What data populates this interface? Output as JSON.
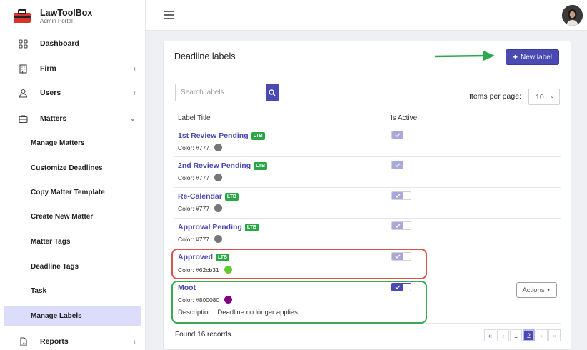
{
  "brand": {
    "title": "LawToolBox",
    "subtitle": "Admin Portal"
  },
  "sidebar": {
    "items": [
      {
        "label": "Dashboard",
        "icon": "grid-icon"
      },
      {
        "label": "Firm",
        "icon": "building-icon"
      },
      {
        "label": "Users",
        "icon": "users-icon"
      },
      {
        "label": "Matters",
        "icon": "briefcase-icon"
      },
      {
        "label": "Reports",
        "icon": "report-icon"
      }
    ],
    "subitems": [
      "Manage Matters",
      "Customize Deadlines",
      "Copy Matter Template",
      "Create New Matter",
      "Matter Tags",
      "Deadline Tags",
      "Task",
      "Manage Labels"
    ],
    "active": "Manage Labels"
  },
  "card": {
    "title": "Deadline labels",
    "new_label_button": "New label",
    "search_placeholder": "Search labels",
    "items_per_page_label": "Items per page:",
    "items_per_page_value": "10",
    "col_label_title": "Label Title",
    "col_is_active": "Is Active",
    "ltb_badge": "LTB",
    "actions_button": "Actions",
    "found": "Found 16 records.",
    "pager": [
      "«",
      "‹",
      "1",
      "2",
      "›",
      "»"
    ],
    "current_page": "2"
  },
  "labels": [
    {
      "title": "1st Review Pending",
      "ltb": true,
      "color_text": "Color: #777",
      "color": "#777777",
      "active": true
    },
    {
      "title": "2nd Review Pending",
      "ltb": true,
      "color_text": "Color: #777",
      "color": "#777777",
      "active": true
    },
    {
      "title": "Re-Calendar",
      "ltb": true,
      "color_text": "Color: #777",
      "color": "#777777",
      "active": true
    },
    {
      "title": "Approval Pending",
      "ltb": true,
      "color_text": "Color: #777",
      "color": "#777777",
      "active": true
    },
    {
      "title": "Approved",
      "ltb": true,
      "color_text": "Color: #62cb31",
      "color": "#62cb31",
      "active": true
    },
    {
      "title": "Moot",
      "ltb": false,
      "color_text": "Color: #800080",
      "color": "#800080",
      "active": true,
      "description": "Description : Deadline no longer applies"
    }
  ],
  "colors": {
    "accent": "#4b4ab3",
    "ltb_badge": "#28a745",
    "highlight_red": "#d9534f",
    "highlight_green": "#3aa855",
    "active_nav": "#dcdcfb"
  }
}
